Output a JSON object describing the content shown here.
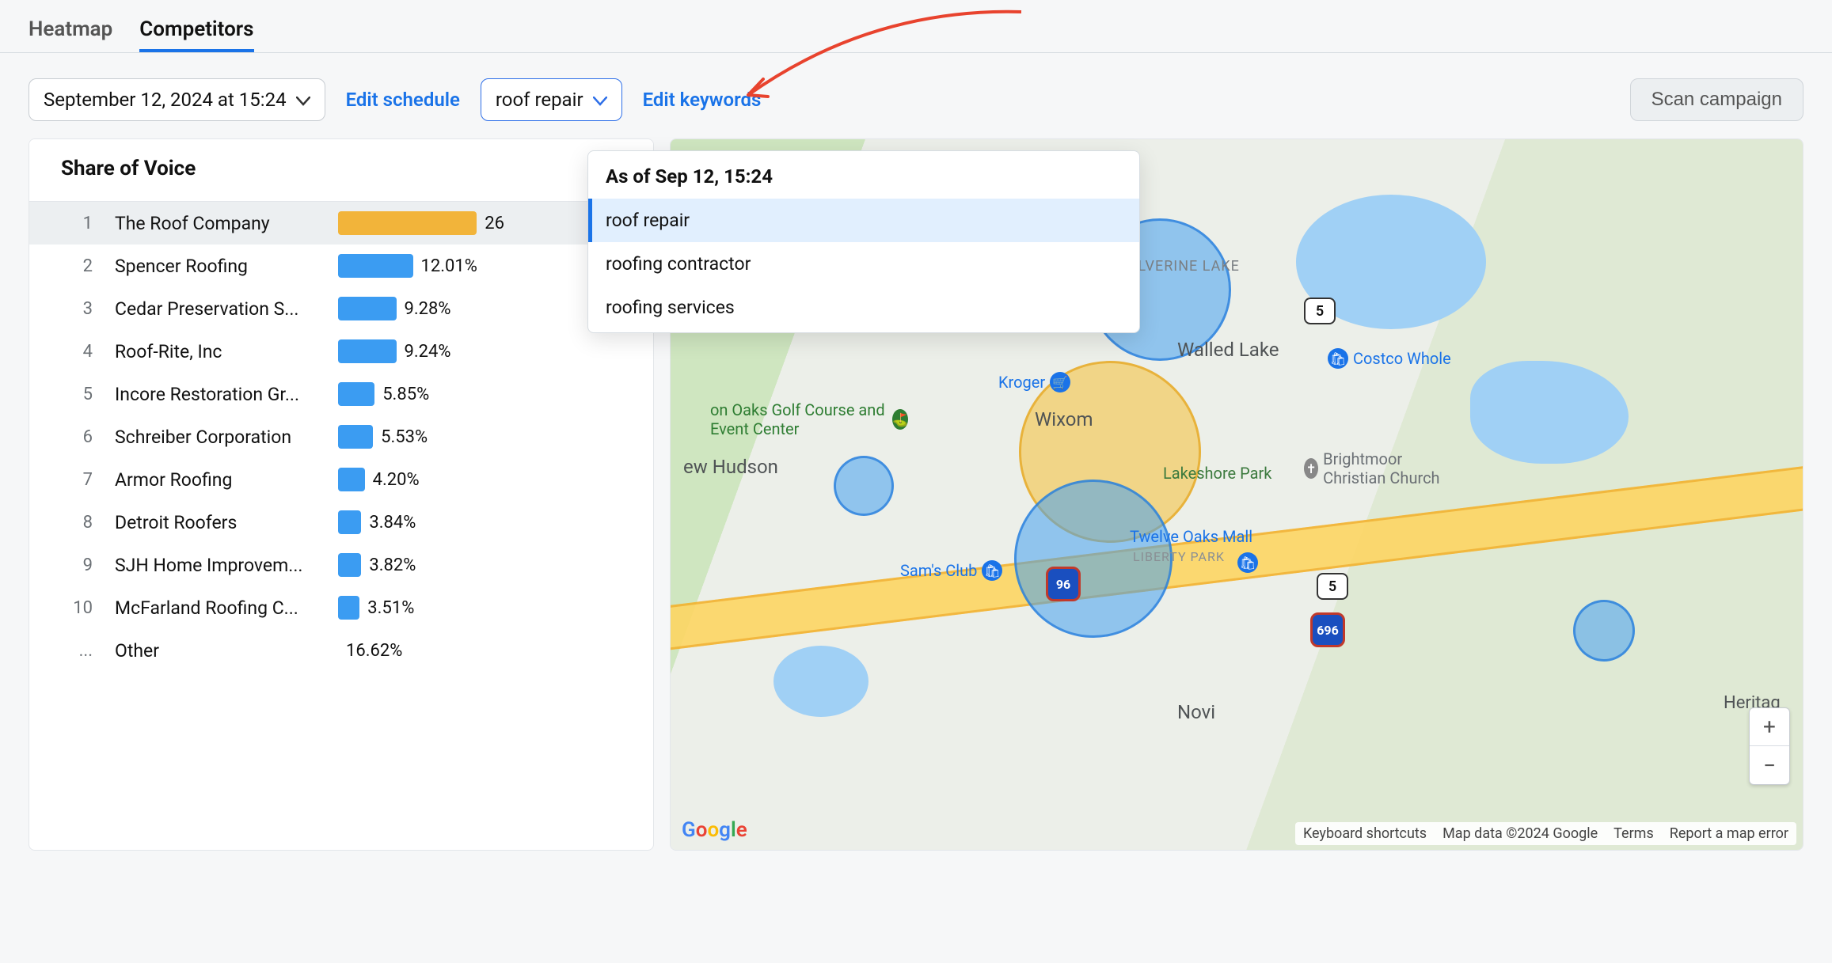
{
  "tabs": {
    "heatmap": "Heatmap",
    "competitors": "Competitors"
  },
  "toolbar": {
    "datetime_label": "September 12, 2024 at 15:24",
    "edit_schedule": "Edit schedule",
    "keyword_selected": "roof repair",
    "edit_keywords": "Edit keywords",
    "scan_campaign": "Scan campaign"
  },
  "keyword_dropdown": {
    "header": "As of Sep 12, 15:24",
    "items": [
      "roof repair",
      "roofing contractor",
      "roofing services"
    ],
    "selected_index": 0
  },
  "sov": {
    "title": "Share of Voice",
    "rows": [
      {
        "rank": "1",
        "name": "The Roof Company",
        "pct_text": "26",
        "bar_pct": 100,
        "highlight": true
      },
      {
        "rank": "2",
        "name": "Spencer Roofing",
        "pct_text": "12.01%",
        "bar_pct": 45
      },
      {
        "rank": "3",
        "name": "Cedar Preservation S...",
        "pct_text": "9.28%",
        "bar_pct": 35
      },
      {
        "rank": "4",
        "name": "Roof-Rite, Inc",
        "pct_text": "9.24%",
        "bar_pct": 35
      },
      {
        "rank": "5",
        "name": "Incore Restoration Gr...",
        "pct_text": "5.85%",
        "bar_pct": 22
      },
      {
        "rank": "6",
        "name": "Schreiber Corporation",
        "pct_text": "5.53%",
        "bar_pct": 21
      },
      {
        "rank": "7",
        "name": "Armor Roofing",
        "pct_text": "4.20%",
        "bar_pct": 16
      },
      {
        "rank": "8",
        "name": "Detroit Roofers",
        "pct_text": "3.84%",
        "bar_pct": 14
      },
      {
        "rank": "9",
        "name": "SJH Home Improvem...",
        "pct_text": "3.82%",
        "bar_pct": 14
      },
      {
        "rank": "10",
        "name": "McFarland Roofing C...",
        "pct_text": "3.51%",
        "bar_pct": 13
      },
      {
        "rank": "...",
        "name": "Other",
        "pct_text": "16.62%",
        "bar_pct": 0
      }
    ]
  },
  "map": {
    "places": {
      "wixom": "Wixom",
      "walled_lake": "Walled Lake",
      "wolverine_lake": "WOLVERINE LAKE",
      "ew_hudson": "ew Hudson",
      "novi": "Novi",
      "lakeshore_park": "Lakeshore Park",
      "liberty_park": "LIBERTY PARK",
      "heritage": "Heritag"
    },
    "pois": {
      "kroger": "Kroger",
      "sams": "Sam's Club",
      "twelve_oaks": "Twelve Oaks Mall",
      "costco": "Costco Whole",
      "oaks_golf": "on Oaks Golf Course and Event Center",
      "brightmoor": "Brightmoor Christian Church"
    },
    "shields": {
      "route_5a": "5",
      "route_5b": "5",
      "i96": "96",
      "i696": "696"
    },
    "footer": {
      "keyboard": "Keyboard shortcuts",
      "mapdata": "Map data ©2024 Google",
      "terms": "Terms",
      "report": "Report a map error"
    },
    "google_logo": [
      "G",
      "o",
      "o",
      "g",
      "l",
      "e"
    ]
  }
}
